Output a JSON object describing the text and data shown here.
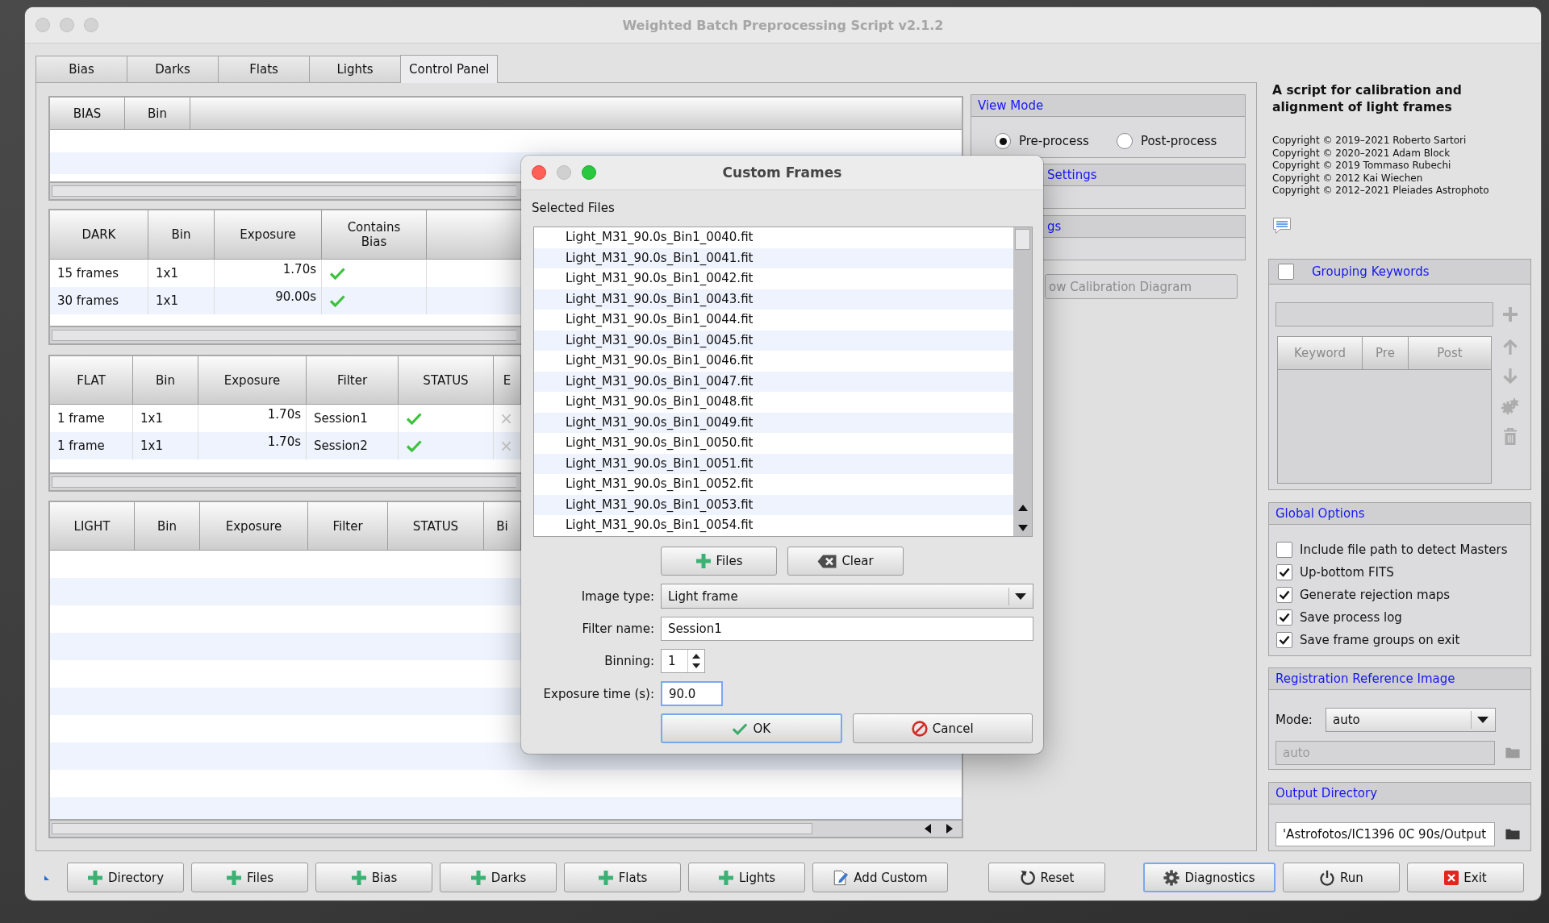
{
  "window": {
    "title": "Weighted Batch Preprocessing Script v2.1.2",
    "active": false
  },
  "tabs": [
    {
      "label": "Bias",
      "selected": false
    },
    {
      "label": "Darks",
      "selected": false
    },
    {
      "label": "Flats",
      "selected": false
    },
    {
      "label": "Lights",
      "selected": false
    },
    {
      "label": "Control Panel",
      "selected": true
    }
  ],
  "tables": [
    {
      "columns": [
        "BIAS",
        "Bin"
      ]
    },
    {
      "columns": [
        "DARK",
        "Bin",
        "Exposure",
        "Contains Bias"
      ],
      "rows": [
        {
          "cells": [
            {
              "kind": "text",
              "text": "15 frames"
            },
            {
              "kind": "text",
              "text": "1x1"
            },
            {
              "kind": "number",
              "text": "1.70s"
            },
            {
              "kind": "flag",
              "value": true
            }
          ]
        },
        {
          "cells": [
            {
              "kind": "text",
              "text": "30 frames"
            },
            {
              "kind": "text",
              "text": "1x1"
            },
            {
              "kind": "number",
              "text": "90.00s"
            },
            {
              "kind": "flag",
              "value": true
            }
          ]
        }
      ]
    },
    {
      "columns": [
        "FLAT",
        "Bin",
        "Exposure",
        "Filter",
        "STATUS",
        "E"
      ],
      "rows": [
        {
          "cells": [
            {
              "kind": "text",
              "text": "1 frame"
            },
            {
              "kind": "text",
              "text": "1x1"
            },
            {
              "kind": "number",
              "text": "1.70s"
            },
            {
              "kind": "text",
              "text": "Session1"
            },
            {
              "kind": "flag",
              "value": true
            },
            {
              "kind": "flag",
              "value": false
            }
          ]
        },
        {
          "cells": [
            {
              "kind": "text",
              "text": "1 frame"
            },
            {
              "kind": "text",
              "text": "1x1"
            },
            {
              "kind": "number",
              "text": "1.70s"
            },
            {
              "kind": "text",
              "text": "Session2"
            },
            {
              "kind": "flag",
              "value": true
            },
            {
              "kind": "flag",
              "value": false
            }
          ]
        }
      ]
    },
    {
      "columns": [
        "LIGHT",
        "Bin",
        "Exposure",
        "Filter",
        "STATUS",
        "Bi"
      ]
    }
  ],
  "view_mode": {
    "title": "View Mode",
    "options": [
      {
        "label": "Pre-process",
        "selected": true
      },
      {
        "label": "Post-process",
        "selected": false
      }
    ]
  },
  "covered_sections": [
    {
      "title": "Settings"
    },
    {
      "title": "gs"
    }
  ],
  "calibration_button": {
    "label": "ow Calibration Diagram",
    "disabled": true
  },
  "about": {
    "heading": "A script for calibration and alignment of light frames",
    "copyrights": [
      "Copyright © 2019–2021 Roberto Sartori",
      "Copyright © 2020–2021 Adam Block",
      "Copyright © 2019 Tommaso Rubechi",
      "Copyright © 2012 Kai Wiechen",
      "Copyright © 2012–2021 Pleiades Astrophoto"
    ]
  },
  "grouping_keywords": {
    "title": "Grouping Keywords",
    "checked": false,
    "disabled": true,
    "columns": [
      "Keyword",
      "Pre",
      "Post"
    ]
  },
  "global_options": {
    "title": "Global Options",
    "options": [
      {
        "label": "Include file path to detect Masters",
        "checked": false
      },
      {
        "label": "Up-bottom FITS",
        "checked": true
      },
      {
        "label": "Generate rejection maps",
        "checked": true
      },
      {
        "label": "Save process log",
        "checked": true
      },
      {
        "label": "Save frame groups on exit",
        "checked": true
      }
    ]
  },
  "registration_reference": {
    "title": "Registration Reference Image",
    "mode_label": "Mode:",
    "mode": "auto",
    "path": {
      "value": "auto",
      "disabled": true
    }
  },
  "output_directory": {
    "title": "Output Directory",
    "value": "'Astrofotos/IC1396 0C 90s/Output"
  },
  "toolbar": {
    "buttons": [
      {
        "label": "Directory",
        "kind": "add",
        "focused": false
      },
      {
        "label": "Files",
        "kind": "add",
        "focused": false
      },
      {
        "label": "Bias",
        "kind": "add",
        "focused": false
      },
      {
        "label": "Darks",
        "kind": "add",
        "focused": false
      },
      {
        "label": "Flats",
        "kind": "add",
        "focused": false
      },
      {
        "label": "Lights",
        "kind": "add",
        "focused": false
      },
      {
        "label": "Add Custom",
        "kind": "custom",
        "focused": false
      },
      {
        "label": "Reset",
        "kind": "reset",
        "focused": false
      },
      {
        "label": "Diagnostics",
        "kind": "diagnostics",
        "focused": true
      },
      {
        "label": "Run",
        "kind": "run",
        "focused": false
      },
      {
        "label": "Exit",
        "kind": "exit",
        "focused": false
      }
    ]
  },
  "dialog": {
    "title": "Custom Frames",
    "active": true,
    "files_label": "Selected Files",
    "files": [
      "Light_M31_90.0s_Bin1_0040.fit",
      "Light_M31_90.0s_Bin1_0041.fit",
      "Light_M31_90.0s_Bin1_0042.fit",
      "Light_M31_90.0s_Bin1_0043.fit",
      "Light_M31_90.0s_Bin1_0044.fit",
      "Light_M31_90.0s_Bin1_0045.fit",
      "Light_M31_90.0s_Bin1_0046.fit",
      "Light_M31_90.0s_Bin1_0047.fit",
      "Light_M31_90.0s_Bin1_0048.fit",
      "Light_M31_90.0s_Bin1_0049.fit",
      "Light_M31_90.0s_Bin1_0050.fit",
      "Light_M31_90.0s_Bin1_0051.fit",
      "Light_M31_90.0s_Bin1_0052.fit",
      "Light_M31_90.0s_Bin1_0053.fit",
      "Light_M31_90.0s_Bin1_0054.fit"
    ],
    "buttons": [
      {
        "label": "Files",
        "kind": "add"
      },
      {
        "label": "Clear",
        "kind": "clear"
      }
    ],
    "fields": [
      {
        "kind": "dropdown",
        "label": "Image type:",
        "value": "Light frame"
      },
      {
        "kind": "text",
        "label": "Filter name:",
        "value": "Session1",
        "focused": false
      },
      {
        "kind": "spinbox",
        "label": "Binning:",
        "value": "1"
      },
      {
        "kind": "number",
        "label": "Exposure time (s):",
        "value": "90.0",
        "focused": true
      }
    ],
    "actions": [
      {
        "label": "OK",
        "kind": "ok",
        "focused": true
      },
      {
        "label": "Cancel",
        "kind": "cancel",
        "focused": false
      }
    ]
  }
}
